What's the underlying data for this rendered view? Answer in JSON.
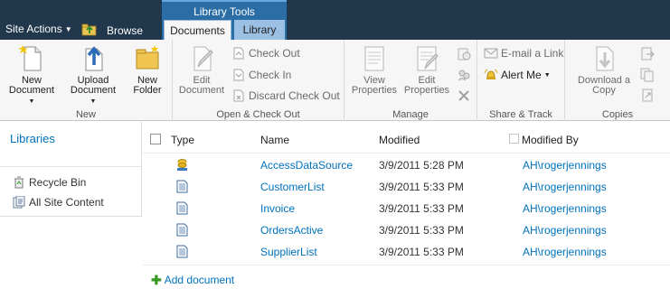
{
  "topbar": {
    "site_actions": "Site Actions",
    "browse_tab": "Browse",
    "context_group": "Library Tools",
    "documents_tab": "Documents",
    "library_tab": "Library"
  },
  "ribbon": {
    "new": {
      "label": "New",
      "new_document": "New Document",
      "upload_document": "Upload Document",
      "new_folder": "New Folder"
    },
    "open_checkout": {
      "label": "Open & Check Out",
      "edit_document": "Edit Document",
      "check_out": "Check Out",
      "check_in": "Check In",
      "discard_check_out": "Discard Check Out"
    },
    "manage": {
      "label": "Manage",
      "view_properties": "View Properties",
      "edit_properties": "Edit Properties"
    },
    "share_track": {
      "label": "Share & Track",
      "email_link": "E-mail a Link",
      "alert_me": "Alert Me"
    },
    "copies": {
      "label": "Copies",
      "download_copy": "Download a Copy"
    }
  },
  "leftnav": {
    "libraries": "Libraries",
    "recycle_bin": "Recycle Bin",
    "all_site_content": "All Site Content"
  },
  "list": {
    "columns": {
      "type": "Type",
      "name": "Name",
      "modified": "Modified",
      "modified_by": "Modified By"
    },
    "rows": [
      {
        "icon": "data-source-icon",
        "name": "AccessDataSource",
        "modified": "3/9/2011 5:28 PM",
        "modified_by": "AH\\rogerjennings"
      },
      {
        "icon": "document-icon",
        "name": "CustomerList",
        "modified": "3/9/2011 5:33 PM",
        "modified_by": "AH\\rogerjennings"
      },
      {
        "icon": "document-icon",
        "name": "Invoice",
        "modified": "3/9/2011 5:33 PM",
        "modified_by": "AH\\rogerjennings"
      },
      {
        "icon": "document-icon",
        "name": "OrdersActive",
        "modified": "3/9/2011 5:33 PM",
        "modified_by": "AH\\rogerjennings"
      },
      {
        "icon": "document-icon",
        "name": "SupplierList",
        "modified": "3/9/2011 5:33 PM",
        "modified_by": "AH\\rogerjennings"
      }
    ],
    "add_document": "Add document"
  },
  "colors": {
    "topbar": "#21374c",
    "context_group": "#2b6ea6",
    "link": "#0072bc",
    "ribbon": "#f6f6f6"
  }
}
